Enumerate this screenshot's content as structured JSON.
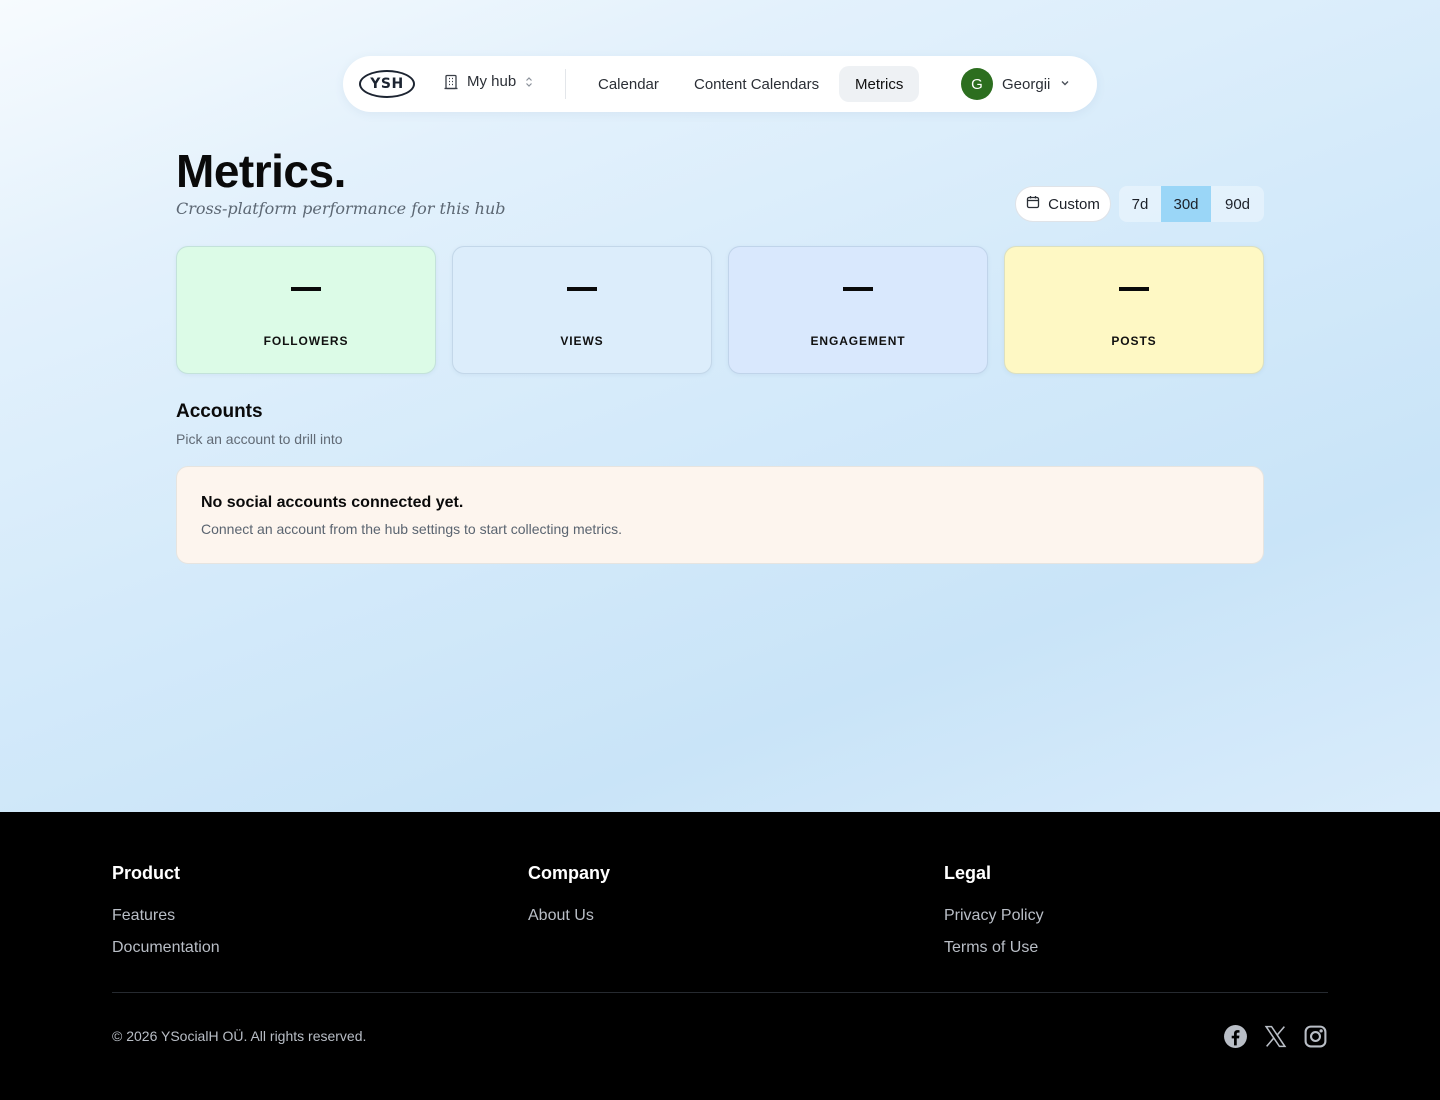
{
  "nav": {
    "logo_text": "YSH",
    "hub_label": "My hub",
    "links": [
      "Calendar",
      "Content Calendars",
      "Metrics"
    ],
    "active_link": "Metrics",
    "user": {
      "initial": "G",
      "name": "Georgii",
      "avatar_color": "#2c6e1f"
    }
  },
  "header": {
    "title": "Metrics.",
    "subtitle": "Cross-platform performance for this hub",
    "custom_label": "Custom",
    "ranges": [
      "7d",
      "30d",
      "90d"
    ],
    "selected_range": "30d"
  },
  "stats": [
    {
      "value": "—",
      "label": "FOLLOWERS",
      "color": "#dcfbe7"
    },
    {
      "value": "—",
      "label": "VIEWS",
      "color": "#dcedfb"
    },
    {
      "value": "—",
      "label": "ENGAGEMENT",
      "color": "#d9e8fd"
    },
    {
      "value": "—",
      "label": "POSTS",
      "color": "#fef8c4"
    }
  ],
  "accounts": {
    "title": "Accounts",
    "subtitle": "Pick an account to drill into",
    "empty_title": "No social accounts connected yet.",
    "empty_desc": "Connect an account from the hub settings to start collecting metrics."
  },
  "footer": {
    "columns": [
      {
        "heading": "Product",
        "links": [
          "Features",
          "Documentation"
        ]
      },
      {
        "heading": "Company",
        "links": [
          "About Us"
        ]
      },
      {
        "heading": "Legal",
        "links": [
          "Privacy Policy",
          "Terms of Use"
        ]
      }
    ],
    "copyright": "© 2026 YSocialH OÜ. All rights reserved.",
    "socials": [
      "facebook-icon",
      "x-icon",
      "instagram-icon"
    ]
  }
}
